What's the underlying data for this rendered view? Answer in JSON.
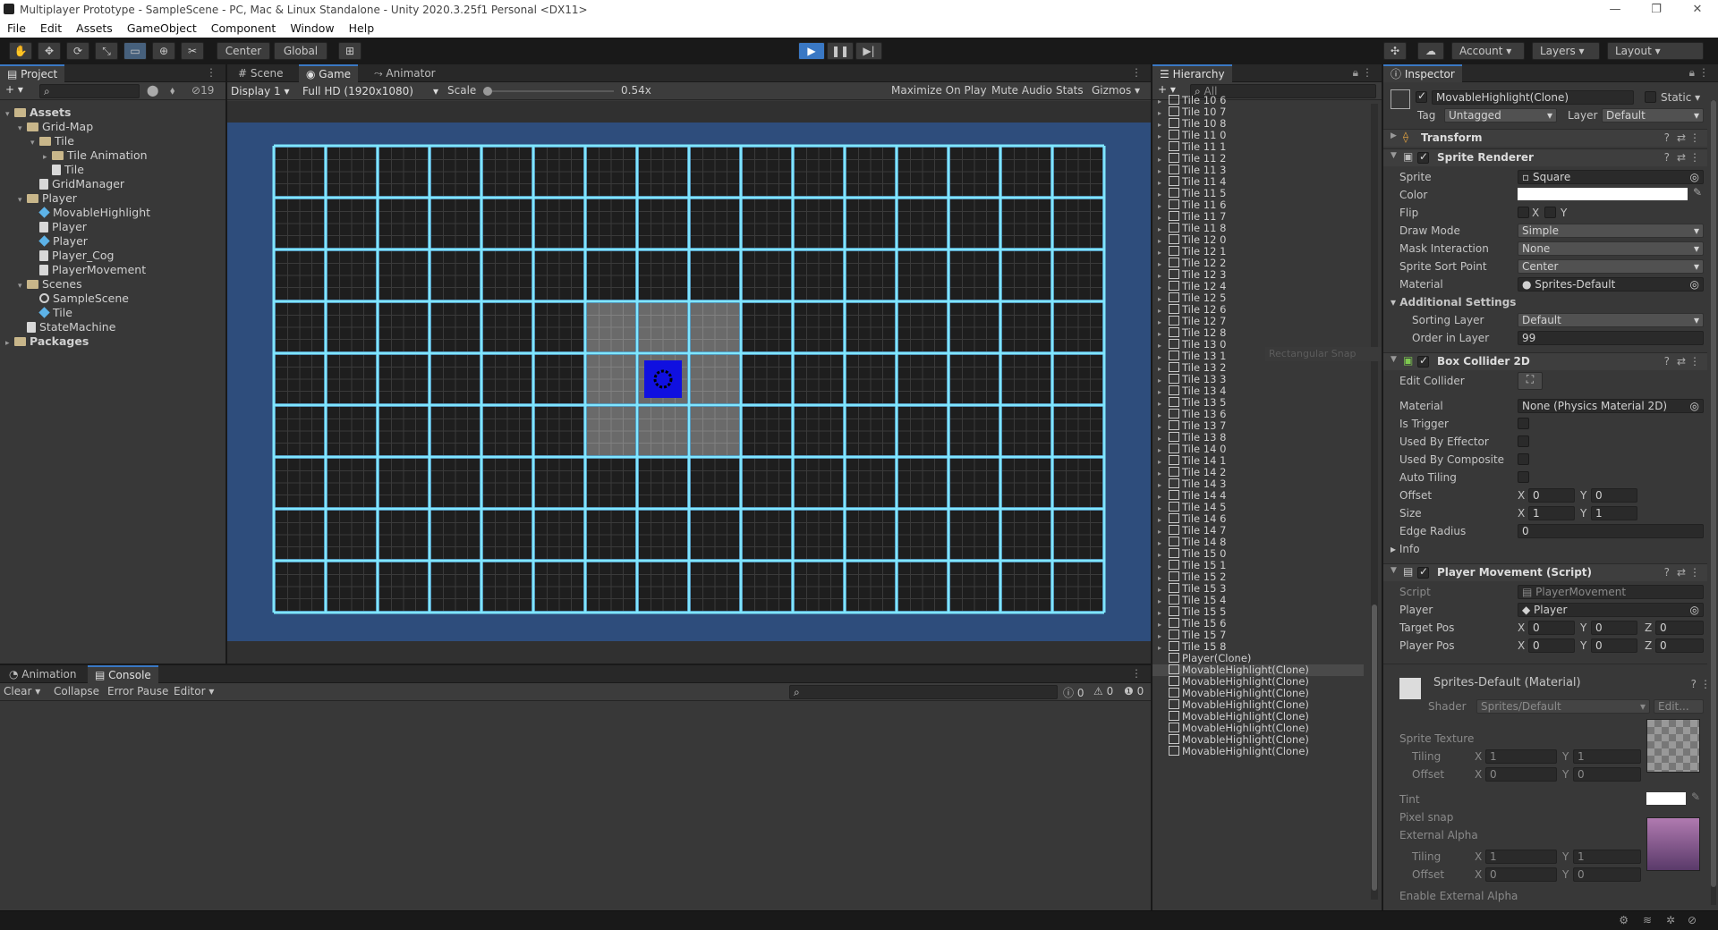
{
  "window": {
    "title": "Multiplayer Prototype - SampleScene - PC, Mac & Linux Standalone - Unity 2020.3.25f1 Personal <DX11>",
    "controls": [
      "—",
      "❐",
      "✕"
    ]
  },
  "menu": [
    "File",
    "Edit",
    "Assets",
    "GameObject",
    "Component",
    "Window",
    "Help"
  ],
  "toolbar": {
    "pivot": "Center",
    "space": "Global",
    "account": "Account",
    "layers": "Layers",
    "layout": "Layout"
  },
  "project": {
    "tab": "Project",
    "hidden_count": "19",
    "tree": [
      {
        "label": "Assets",
        "indent": 0,
        "icon": "folder",
        "bold": true
      },
      {
        "label": "Grid-Map",
        "indent": 1,
        "icon": "folder"
      },
      {
        "label": "Tile",
        "indent": 2,
        "icon": "folder"
      },
      {
        "label": "Tile Animation",
        "indent": 3,
        "icon": "folder"
      },
      {
        "label": "Tile",
        "indent": 3,
        "icon": "script"
      },
      {
        "label": "GridManager",
        "indent": 2,
        "icon": "script"
      },
      {
        "label": "Player",
        "indent": 1,
        "icon": "folder"
      },
      {
        "label": "MovableHighlight",
        "indent": 2,
        "icon": "prefab"
      },
      {
        "label": "Player",
        "indent": 2,
        "icon": "script"
      },
      {
        "label": "Player",
        "indent": 2,
        "icon": "prefab"
      },
      {
        "label": "Player_Cog",
        "indent": 2,
        "icon": "script"
      },
      {
        "label": "PlayerMovement",
        "indent": 2,
        "icon": "script"
      },
      {
        "label": "Scenes",
        "indent": 1,
        "icon": "folder"
      },
      {
        "label": "SampleScene",
        "indent": 2,
        "icon": "scene"
      },
      {
        "label": "Tile",
        "indent": 2,
        "icon": "prefab"
      },
      {
        "label": "StateMachine",
        "indent": 1,
        "icon": "script"
      },
      {
        "label": "Packages",
        "indent": 0,
        "icon": "folder",
        "bold": true
      }
    ]
  },
  "game": {
    "tabs": [
      "Scene",
      "Game",
      "Animator"
    ],
    "display": "Display 1",
    "resolution": "Full HD (1920x1080)",
    "scale_label": "Scale",
    "scale_value": "0.54x",
    "options": [
      "Maximize On Play",
      "Mute Audio",
      "Stats",
      "Gizmos"
    ],
    "grid": {
      "cols": 16,
      "rows": 9,
      "highlight_row": 4,
      "highlight_col": 7
    }
  },
  "console": {
    "tabs": [
      "Animation",
      "Console"
    ],
    "buttons": [
      "Clear",
      "Collapse",
      "Error Pause",
      "Editor"
    ],
    "counts": [
      "0",
      "0",
      "0"
    ]
  },
  "hierarchy": {
    "tab": "Hierarchy",
    "search_placeholder": "All",
    "items": [
      "Tile 10 6",
      "Tile 10 7",
      "Tile 10 8",
      "Tile 11 0",
      "Tile 11 1",
      "Tile 11 2",
      "Tile 11 3",
      "Tile 11 4",
      "Tile 11 5",
      "Tile 11 6",
      "Tile 11 7",
      "Tile 11 8",
      "Tile 12 0",
      "Tile 12 1",
      "Tile 12 2",
      "Tile 12 3",
      "Tile 12 4",
      "Tile 12 5",
      "Tile 12 6",
      "Tile 12 7",
      "Tile 12 8",
      "Tile 13 0",
      "Tile 13 1",
      "Tile 13 2",
      "Tile 13 3",
      "Tile 13 4",
      "Tile 13 5",
      "Tile 13 6",
      "Tile 13 7",
      "Tile 13 8",
      "Tile 14 0",
      "Tile 14 1",
      "Tile 14 2",
      "Tile 14 3",
      "Tile 14 4",
      "Tile 14 5",
      "Tile 14 6",
      "Tile 14 7",
      "Tile 14 8",
      "Tile 15 0",
      "Tile 15 1",
      "Tile 15 2",
      "Tile 15 3",
      "Tile 15 4",
      "Tile 15 5",
      "Tile 15 6",
      "Tile 15 7",
      "Tile 15 8",
      "Player(Clone)",
      "MovableHighlight(Clone)",
      "MovableHighlight(Clone)",
      "MovableHighlight(Clone)",
      "MovableHighlight(Clone)",
      "MovableHighlight(Clone)",
      "MovableHighlight(Clone)",
      "MovableHighlight(Clone)",
      "MovableHighlight(Clone)"
    ],
    "tooltip": "Rectangular Snap"
  },
  "inspector": {
    "tab": "Inspector",
    "object_name": "MovableHighlight(Clone)",
    "static_label": "Static",
    "tag_label": "Tag",
    "tag_value": "Untagged",
    "layer_label": "Layer",
    "layer_value": "Default",
    "transform": "Transform",
    "sprite_renderer": {
      "title": "Sprite Renderer",
      "sprite_label": "Sprite",
      "sprite_value": "Square",
      "color_label": "Color",
      "flip_label": "Flip",
      "flip_x": "X",
      "flip_y": "Y",
      "draw_mode_label": "Draw Mode",
      "draw_mode_value": "Simple",
      "mask_label": "Mask Interaction",
      "mask_value": "None",
      "sort_point_label": "Sprite Sort Point",
      "sort_point_value": "Center",
      "material_label": "Material",
      "material_value": "Sprites-Default",
      "additional": "Additional Settings",
      "sorting_layer_label": "Sorting Layer",
      "sorting_layer_value": "Default",
      "order_label": "Order in Layer",
      "order_value": "99"
    },
    "box_collider": {
      "title": "Box Collider 2D",
      "edit_label": "Edit Collider",
      "material_label": "Material",
      "material_value": "None (Physics Material 2D)",
      "trigger_label": "Is Trigger",
      "effector_label": "Used By Effector",
      "composite_label": "Used By Composite",
      "tiling_label": "Auto Tiling",
      "offset_label": "Offset",
      "offset_x": "0",
      "offset_y": "0",
      "size_label": "Size",
      "size_x": "1",
      "size_y": "1",
      "edge_label": "Edge Radius",
      "edge_value": "0",
      "info_label": "Info"
    },
    "player_movement": {
      "title": "Player Movement (Script)",
      "script_label": "Script",
      "script_value": "PlayerMovement",
      "player_label": "Player",
      "player_value": "Player",
      "target_label": "Target Pos",
      "target": [
        "0",
        "0",
        "0"
      ],
      "pos_label": "Player Pos",
      "pos": [
        "0",
        "0",
        "0"
      ]
    },
    "material": {
      "title": "Sprites-Default (Material)",
      "shader_label": "Shader",
      "shader_value": "Sprites/Default",
      "edit_label": "Edit...",
      "texture_label": "Sprite Texture",
      "tiling_label": "Tiling",
      "tiling": [
        "1",
        "1"
      ],
      "offset_label": "Offset",
      "offset": [
        "0",
        "0"
      ],
      "tint_label": "Tint",
      "snap_label": "Pixel snap",
      "alpha_label": "External Alpha",
      "tiling2": [
        "1",
        "1"
      ],
      "offset2": [
        "0",
        "0"
      ],
      "enable_alpha_label": "Enable External Alpha"
    },
    "axis": [
      "X",
      "Y",
      "Z"
    ]
  },
  "colors": {
    "accent": "#3a78c4",
    "grid_line": "#7fe6ff",
    "game_bg": "#2e4d7c",
    "tile": "#1e1e1e",
    "player": "#1010e0"
  }
}
